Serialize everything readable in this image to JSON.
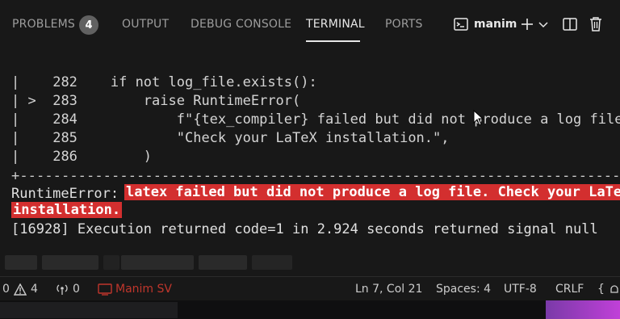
{
  "tabs": [
    {
      "label": "PROBLEMS",
      "badge": "4"
    },
    {
      "label": "OUTPUT"
    },
    {
      "label": "DEBUG CONSOLE"
    },
    {
      "label": "TERMINAL",
      "active": true
    },
    {
      "label": "PORTS"
    }
  ],
  "toolbar": {
    "terminal_name": "manim",
    "icons": [
      "terminal-icon",
      "plus-icon",
      "chevron-down-icon",
      "split-terminal-icon",
      "trash-icon"
    ]
  },
  "terminal": {
    "code_lines": [
      {
        "gutter": "|  ",
        "num": "282",
        "text": "    if not log_file.exists():"
      },
      {
        "gutter": "| >",
        "num": "283",
        "text": "        raise RuntimeError("
      },
      {
        "gutter": "|  ",
        "num": "284",
        "text": "            f\"{tex_compiler} failed but did not produce a log file. \""
      },
      {
        "gutter": "|  ",
        "num": "285",
        "text": "            \"Check your LaTeX installation.\","
      },
      {
        "gutter": "|  ",
        "num": "286",
        "text": "        )"
      }
    ],
    "separator": "+------------------------------------------------------------------------------------------------",
    "error_label": "RuntimeError: ",
    "error_line1": "latex failed but did not produce a log file. Check your LaTeX",
    "error_line2": "installation.",
    "exec_line": "[16928] Execution returned code=1 in 2.924 seconds returned signal null"
  },
  "status": {
    "errors": "0",
    "warnings": "4",
    "ports": "0",
    "remote": "Manim SV",
    "position": "Ln 7, Col 21",
    "spaces": "Spaces: 4",
    "encoding": "UTF-8",
    "eol": "CRLF"
  },
  "colors": {
    "background": "#181818",
    "error_highlight": "#d32f2f",
    "status_red": "#c0362c"
  }
}
